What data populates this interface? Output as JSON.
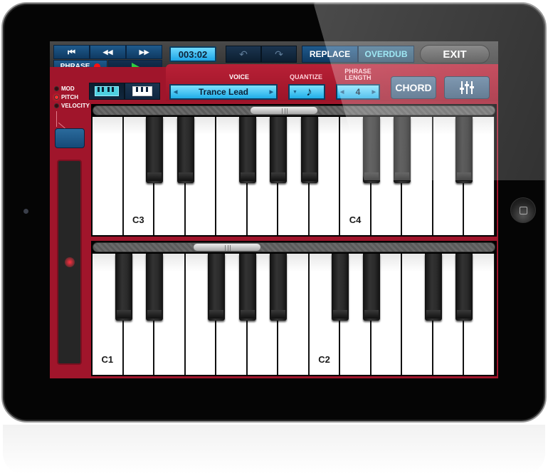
{
  "transport": {
    "skip_start_icon": "⏮",
    "rewind_icon": "◀◀",
    "forward_icon": "▶▶",
    "phrase_label": "PHRASE",
    "time": "003:02"
  },
  "edit": {
    "undo_icon": "↶",
    "redo_icon": "↷"
  },
  "mode": {
    "replace_label": "REPLACE",
    "overdub_label": "OVERDUB",
    "selected": "REPLACE"
  },
  "exit_label": "EXIT",
  "controls": {
    "voice_label": "VOICE",
    "voice_value": "Trance Lead",
    "quantize_label": "QUANTIZE",
    "quantize_value": "♪",
    "phrase_length_label_1": "PHRASE",
    "phrase_length_label_2": "LENGTH",
    "phrase_length_value": "4",
    "chord_label": "CHORD",
    "mixer_icon": "mixer-sliders-icon"
  },
  "modulation": {
    "items": [
      {
        "label": "MOD",
        "active": false
      },
      {
        "label": "PITCH",
        "active": true
      },
      {
        "label": "VELOCITY",
        "active": false
      }
    ],
    "pad_value_fraction": 0.5
  },
  "upper_keyboard": {
    "scroll_position_fraction": 0.47,
    "labels": {
      "C3": 1,
      "C4": 8
    }
  },
  "lower_keyboard": {
    "scroll_position_fraction": 0.3,
    "labels": {
      "C1": 0,
      "C2": 7
    }
  },
  "accent_colors": {
    "panel_red": "#a0152b",
    "display_cyan": "#20aee8",
    "button_blue": "#1f5a8c",
    "record_red": "#ff1010",
    "play_green": "#2ecc40"
  }
}
